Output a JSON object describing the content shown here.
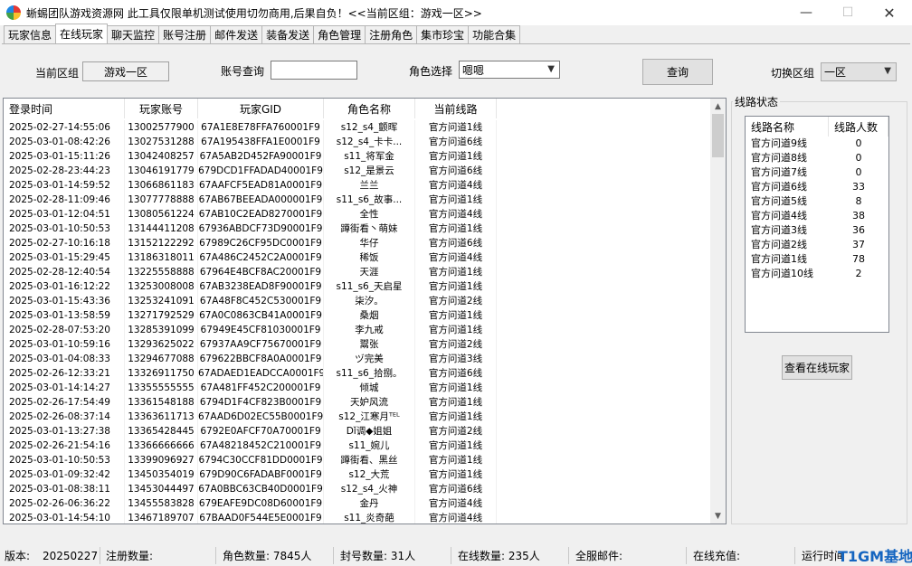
{
  "window": {
    "title": "蜥蜴团队游戏资源网 此工具仅限单机测试使用切勿商用,后果自负！<<当前区组：游戏一区>>",
    "minimize": "—",
    "maximize": "☐",
    "close": "✕"
  },
  "tabs": [
    "玩家信息",
    "在线玩家",
    "聊天监控",
    "账号注册",
    "邮件发送",
    "装备发送",
    "角色管理",
    "注册角色",
    "集市珍宝",
    "功能合集"
  ],
  "toolbar": {
    "current_zone_label": "当前区组",
    "current_zone_value": "游戏一区",
    "account_query_label": "账号查询",
    "account_query_value": "",
    "role_select_label": "角色选择",
    "role_select_value": "嗯嗯",
    "query_button": "查询",
    "switch_zone_label": "切换区组",
    "switch_zone_value": "一区"
  },
  "player_table": {
    "headers": [
      "登录时间",
      "玩家账号",
      "玩家GID",
      "角色名称",
      "当前线路"
    ],
    "rows": [
      [
        "2025-02-27-14:55:06",
        "13002577900",
        "67A1E8E78FFA760001F9",
        "s12_s4_颤晖",
        "官方问道1线"
      ],
      [
        "2025-03-01-08:42:26",
        "13027531288",
        "67A195438FFA1E0001F9",
        "s12_s4_卡卡...",
        "官方问道6线"
      ],
      [
        "2025-03-01-15:11:26",
        "13042408257",
        "67A5AB2D452FA90001F9",
        "s11_将军金",
        "官方问道1线"
      ],
      [
        "2025-02-28-23:44:23",
        "13046191779",
        "679DCD1FFADAD40001F9",
        "s12_是景云",
        "官方问道6线"
      ],
      [
        "2025-03-01-14:59:52",
        "13066861183",
        "67AAFCF5EAD81A0001F9",
        "兰兰",
        "官方问道4线"
      ],
      [
        "2025-02-28-11:09:46",
        "13077778888",
        "67AB67BEEADA000001F9",
        "s11_s6_故事...",
        "官方问道1线"
      ],
      [
        "2025-03-01-12:04:51",
        "13080561224",
        "67AB10C2EAD8270001F9",
        "全性",
        "官方问道4线"
      ],
      [
        "2025-03-01-10:50:53",
        "13144411208",
        "67936ABDCF73D90001F9",
        "蹲街看丶萌妹",
        "官方问道1线"
      ],
      [
        "2025-02-27-10:16:18",
        "13152122292",
        "67989C26CF95DC0001F9",
        "华仔",
        "官方问道6线"
      ],
      [
        "2025-03-01-15:29:45",
        "13186318011",
        "67A486C2452C2A0001F9",
        "稀饭",
        "官方问道4线"
      ],
      [
        "2025-02-28-12:40:54",
        "13225558888",
        "67964E4BCF8AC20001F9",
        "天涯",
        "官方问道1线"
      ],
      [
        "2025-03-01-16:12:22",
        "13253008008",
        "67AB3238EAD8F90001F9",
        "s11_s6_天启星",
        "官方问道1线"
      ],
      [
        "2025-03-01-15:43:36",
        "13253241091",
        "67A48F8C452C530001F9",
        "柒汐。",
        "官方问道2线"
      ],
      [
        "2025-03-01-13:58:59",
        "13271792529",
        "67A0C0863CB41A0001F9",
        "桑烟",
        "官方问道1线"
      ],
      [
        "2025-02-28-07:53:20",
        "13285391099",
        "67949E45CF81030001F9",
        "李九戒",
        "官方问道1线"
      ],
      [
        "2025-03-01-10:59:16",
        "13293625022",
        "67937AA9CF75670001F9",
        "鬻张",
        "官方问道2线"
      ],
      [
        "2025-03-01-04:08:33",
        "13294677088",
        "679622BBCF8A0A0001F9",
        "ヅ完美",
        "官方问道3线"
      ],
      [
        "2025-02-26-12:33:21",
        "13326911750",
        "67ADAED1EADCCA0001F9",
        "s11_s6_拾捌。",
        "官方问道6线"
      ],
      [
        "2025-03-01-14:14:27",
        "13355555555",
        "67A481FF452C200001F9",
        "倾城",
        "官方问道1线"
      ],
      [
        "2025-02-26-17:54:49",
        "13361548188",
        "6794D1F4CF823B0001F9",
        "天妒风流",
        "官方问道1线"
      ],
      [
        "2025-02-26-08:37:14",
        "13363611713",
        "67AAD6D02EC55B0001F9",
        "s12_江寒月ᵀᴱᴸ",
        "官方问道1线"
      ],
      [
        "2025-03-01-13:27:38",
        "13365428445",
        "6792E0AFCF70A70001F9",
        "Dǐ调◆姐姐",
        "官方问道2线"
      ],
      [
        "2025-02-26-21:54:16",
        "13366666666",
        "67A48218452C210001F9",
        "s11_婉儿",
        "官方问道1线"
      ],
      [
        "2025-03-01-10:50:53",
        "13399096927",
        "6794C30CCF81DD0001F9",
        "蹲街看、黑丝",
        "官方问道1线"
      ],
      [
        "2025-03-01-09:32:42",
        "13450354019",
        "679D90C6FADABF0001F9",
        "s12_大荒",
        "官方问道1线"
      ],
      [
        "2025-03-01-08:38:11",
        "13453044497",
        "67A0BBC63CB40D0001F9",
        "s12_s4_火神",
        "官方问道6线"
      ],
      [
        "2025-02-26-06:36:22",
        "13455583828",
        "679EAFE9DC08D60001F9",
        "金丹",
        "官方问道4线"
      ],
      [
        "2025-03-01-14:54:10",
        "13467189707",
        "67BAAD0F544E5E0001F9",
        "s11_炎奇葩",
        "官方问道4线"
      ]
    ]
  },
  "line_status": {
    "group_title": "线路状态",
    "headers": [
      "线路名称",
      "线路人数"
    ],
    "rows": [
      [
        "官方问道9线",
        "0"
      ],
      [
        "官方问道8线",
        "0"
      ],
      [
        "官方问道7线",
        "0"
      ],
      [
        "官方问道6线",
        "33"
      ],
      [
        "官方问道5线",
        "8"
      ],
      [
        "官方问道4线",
        "38"
      ],
      [
        "官方问道3线",
        "36"
      ],
      [
        "官方问道2线",
        "37"
      ],
      [
        "官方问道1线",
        "78"
      ],
      [
        "官方问道10线",
        "2"
      ]
    ],
    "view_online_button": "查看在线玩家"
  },
  "statusbar": {
    "version_label": "版本:",
    "version_value": "20250227",
    "reg_count": "注册数量:",
    "role_count": "角色数量: 7845人",
    "ban_count": "封号数量: 31人",
    "online_count": "在线数量: 235人",
    "all_mail": "全服邮件:",
    "online_recharge": "在线充值:",
    "run_time": "运行时间",
    "watermark": "T1GM基地"
  }
}
